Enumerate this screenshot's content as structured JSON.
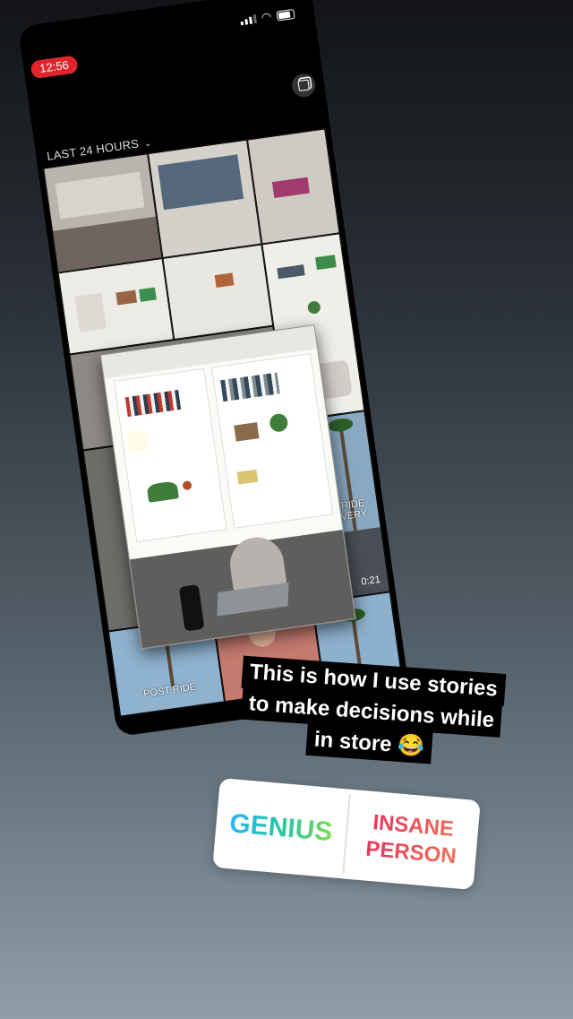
{
  "status_bar": {
    "time": "12:56",
    "icons": [
      "signal-icon",
      "wifi-icon",
      "battery-icon"
    ]
  },
  "gallery": {
    "filter_label": "LAST 24 HOURS",
    "filter_icon": "chevron-down-icon",
    "multi_select_icon": "multi-select-icon",
    "video_1": {
      "overlay": "POST RIDE RECOVERY",
      "duration": "0:21"
    },
    "video_2": {
      "overlay": "POST RIDE"
    }
  },
  "caption": {
    "lines": [
      "This is how I use stories",
      "to make decisions while",
      "in store 😂"
    ]
  },
  "poll": {
    "option_1": "GENIUS",
    "option_2_line1": "INSANE",
    "option_2_line2": "PERSON",
    "colors": {
      "genius": "#33c9c0",
      "insane": "#ee4b6a"
    }
  }
}
